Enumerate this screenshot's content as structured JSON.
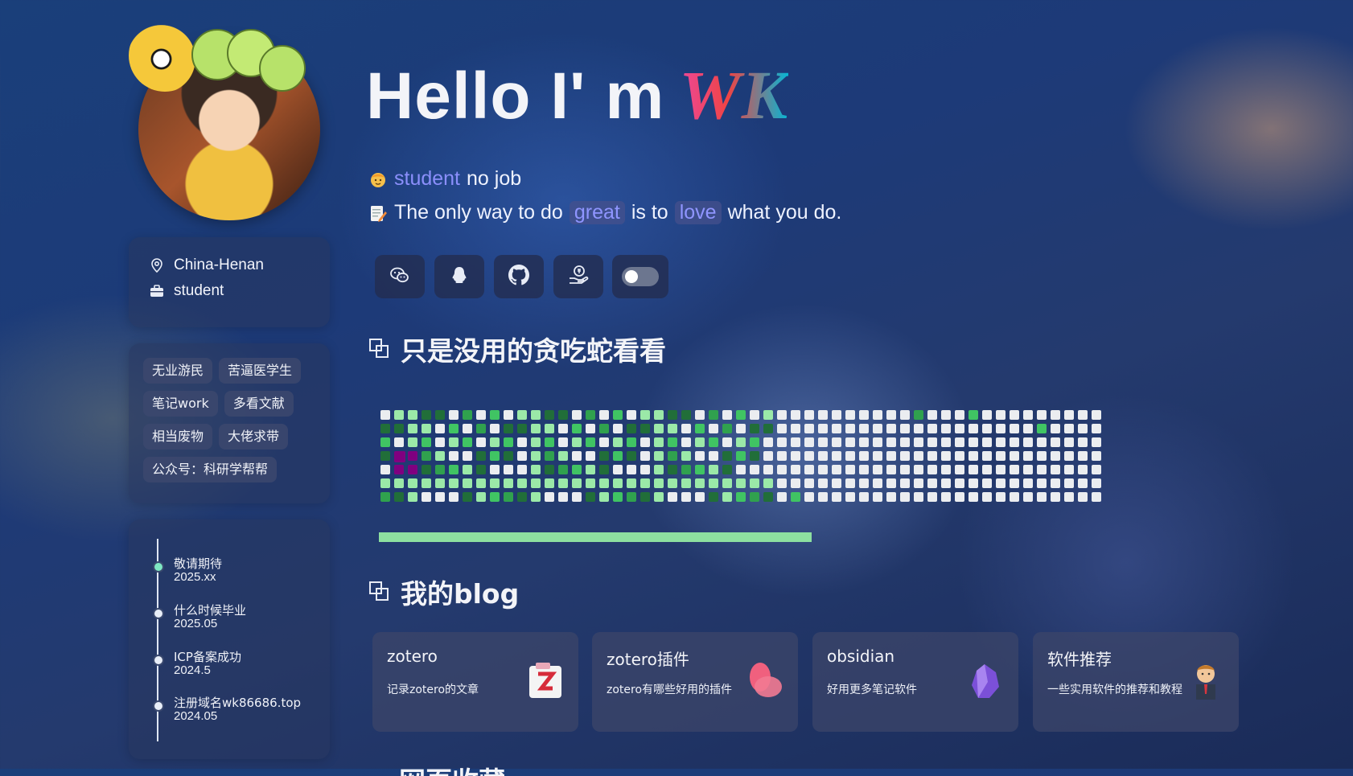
{
  "profile": {
    "name_prefix": "Hello I' m",
    "logo_text": "WK",
    "location": "China-Henan",
    "occupation": "student"
  },
  "intro": {
    "role_highlight": "student",
    "role_rest": "no job",
    "quote_part1": "The only way to do",
    "quote_hl1": "great",
    "quote_part2": "is to",
    "quote_hl2": "love",
    "quote_part3": "what you do."
  },
  "social_links": [
    {
      "icon": "wechat-icon"
    },
    {
      "icon": "qq-icon"
    },
    {
      "icon": "github-icon"
    },
    {
      "icon": "donate-icon"
    },
    {
      "icon": "theme-toggle"
    }
  ],
  "tags": [
    "无业游民",
    "苦逼医学生",
    "笔记work",
    "多看文献",
    "相当废物",
    "大佬求带",
    "公众号：科研学帮帮"
  ],
  "timeline": [
    {
      "title": "敬请期待",
      "date": "2025.xx"
    },
    {
      "title": "什么时候毕业",
      "date": "2025.05"
    },
    {
      "title": "ICP备案成功",
      "date": "2024.5"
    },
    {
      "title": "注册域名wk86686.top",
      "date": "2024.05"
    }
  ],
  "snake_section": {
    "title": "只是没用的贪吃蛇看看",
    "progress": 0.6,
    "colors": {
      "empty": "#ebedf0",
      "light": "#9be9a8",
      "mid": "#40c463",
      "dark": "#30a14e",
      "darkest": "#216e39",
      "snake": "#800080"
    }
  },
  "blog_section": {
    "title": "我的blog",
    "cards": [
      {
        "title": "zotero",
        "desc": "记录zotero的文章",
        "icon": "zotero-icon"
      },
      {
        "title": "zotero插件",
        "desc": "zotero有哪些好用的插件",
        "icon": "petal-icon"
      },
      {
        "title": "obsidian",
        "desc": "好用更多笔记软件",
        "icon": "obsidian-icon"
      },
      {
        "title": "软件推荐",
        "desc": "一些实用软件的推荐和教程",
        "icon": "businessman-icon"
      }
    ]
  },
  "next_section": {
    "title": "网页收藏"
  }
}
